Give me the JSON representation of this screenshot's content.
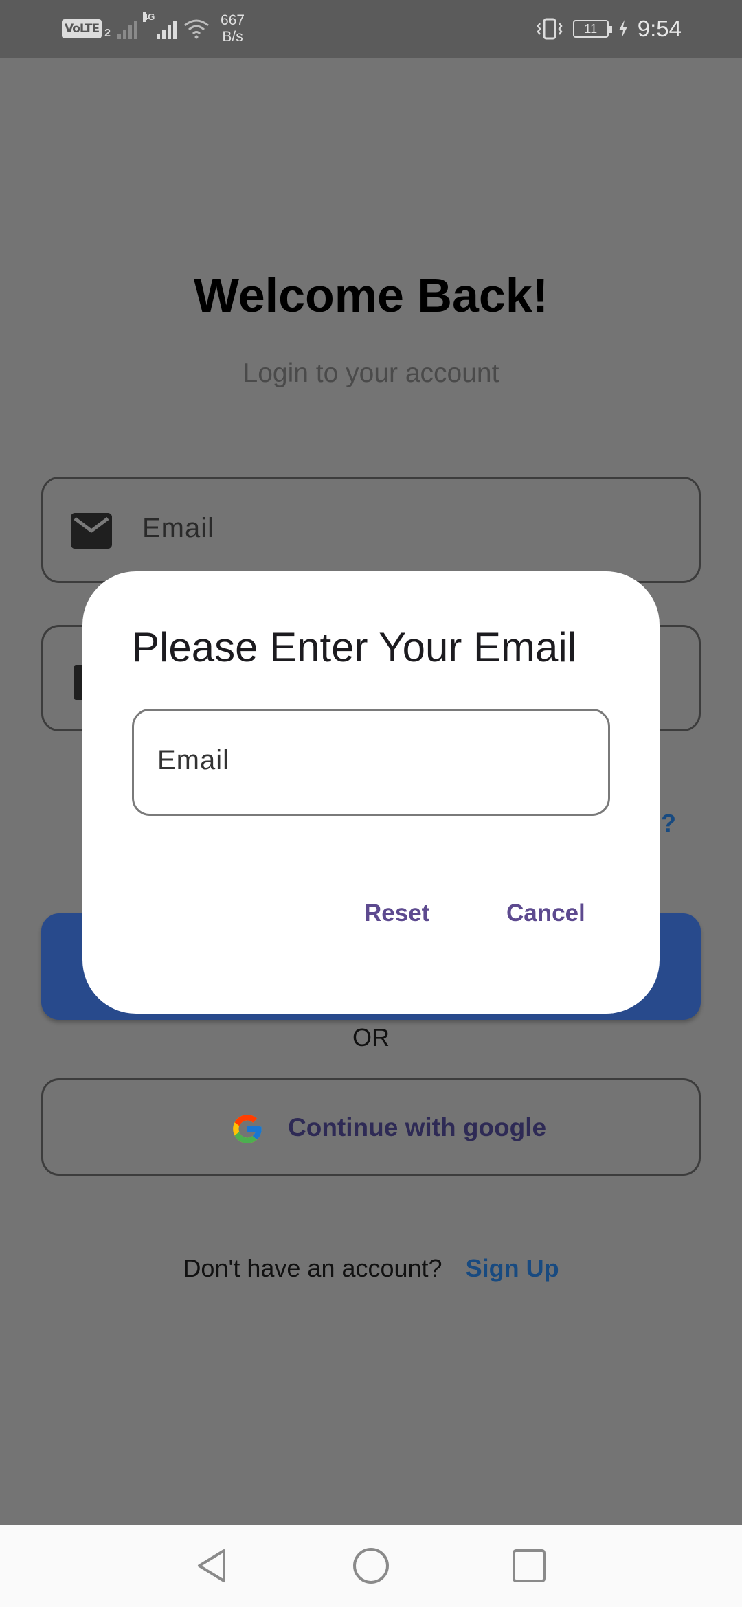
{
  "status_bar": {
    "volte": "VoLTE",
    "sim_number": "2",
    "network_type": "4G",
    "net_speed_value": "667",
    "net_speed_unit": "B/s",
    "battery_level": "11",
    "time": "9:54"
  },
  "screen": {
    "title": "Welcome Back!",
    "subtitle": "Login to your account",
    "email_label": "Email",
    "forgot_partial": "d?",
    "or_text": "OR",
    "google_button": "Continue with google",
    "signup_prompt": "Don't have an account?",
    "signup_link": "Sign Up"
  },
  "dialog": {
    "title": "Please Enter Your Email",
    "email_label": "Email",
    "reset_button": "Reset",
    "cancel_button": "Cancel"
  },
  "colors": {
    "scrim": "#747474",
    "primary": "#284a8c",
    "dialog_action": "#5d4a8f",
    "link": "#184a80"
  }
}
